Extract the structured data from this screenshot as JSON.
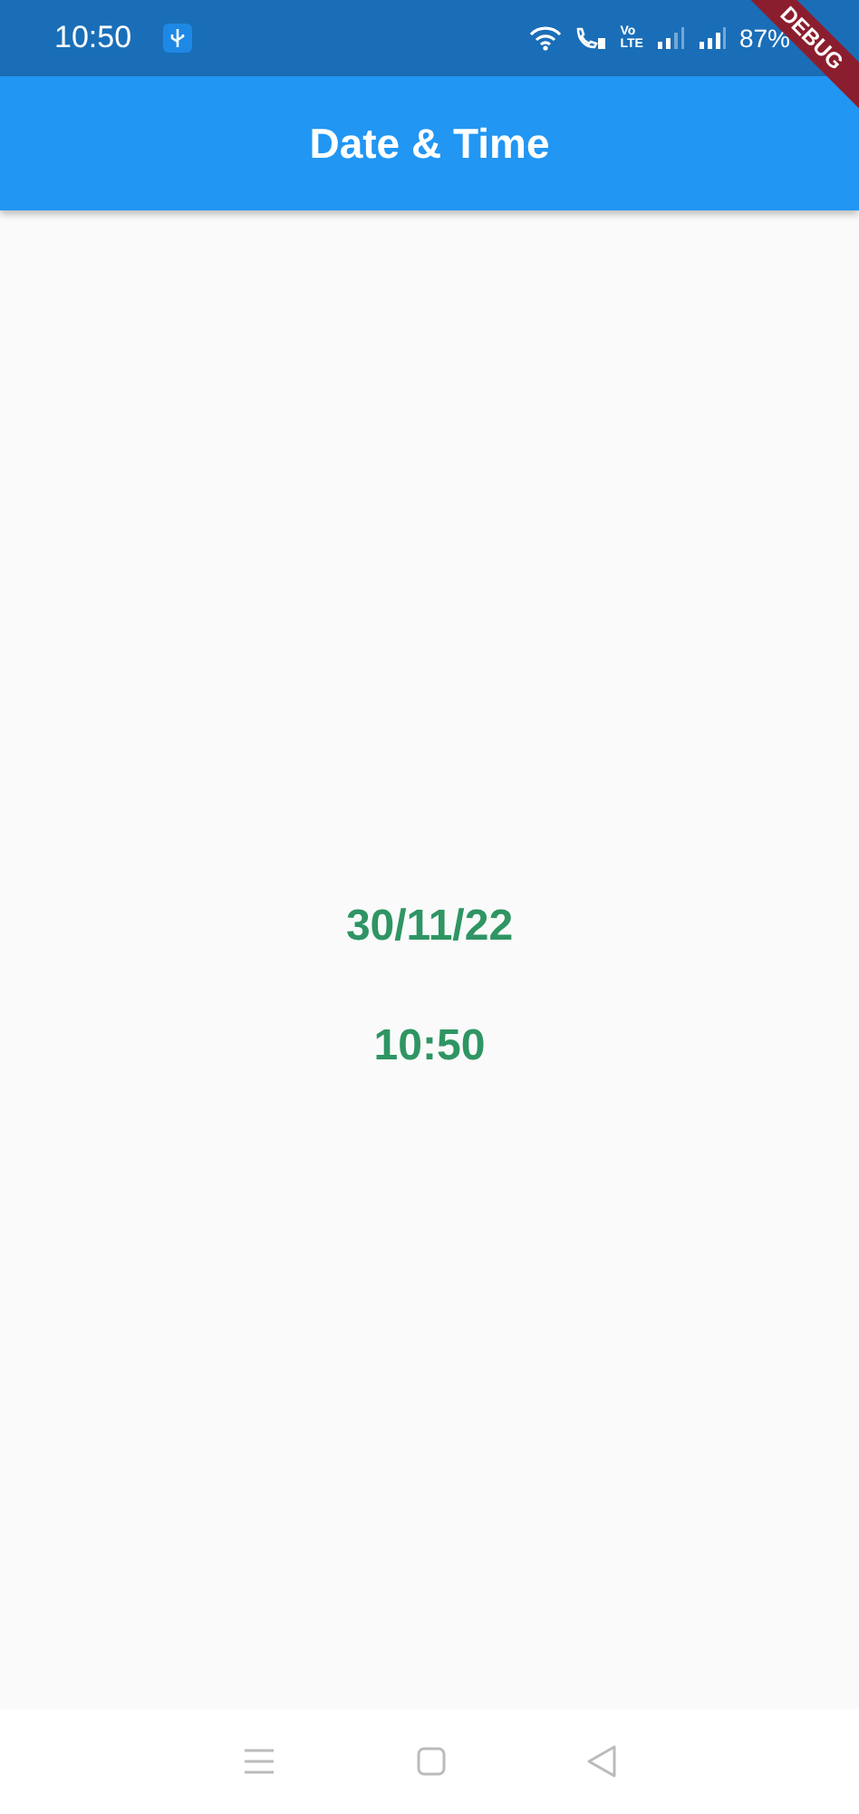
{
  "status_bar": {
    "time": "10:50",
    "volte": {
      "top": "Vo",
      "bottom": "LTE"
    },
    "battery": "87%"
  },
  "debug_banner": "DEBUG",
  "app_bar": {
    "title": "Date & Time"
  },
  "content": {
    "date": "30/11/22",
    "time": "10:50"
  }
}
